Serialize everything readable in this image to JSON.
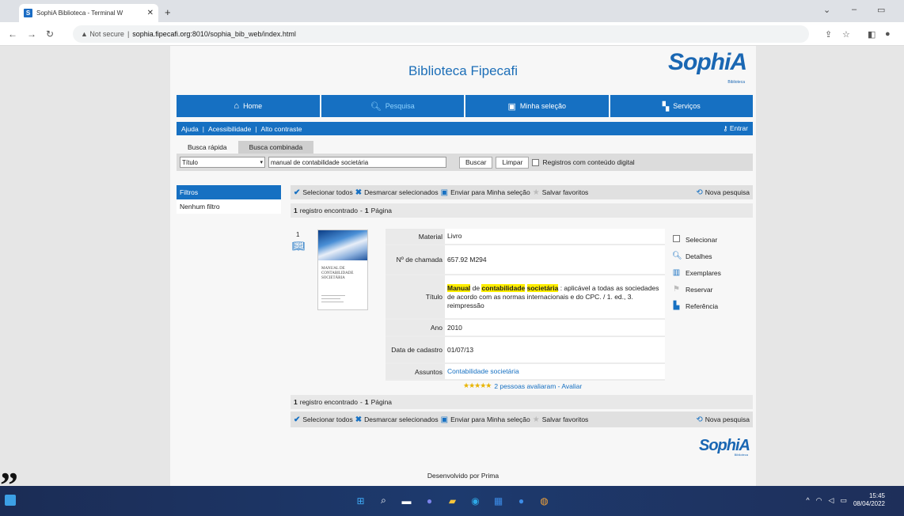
{
  "browser": {
    "tab_title": "SophiA Biblioteca - Terminal W",
    "favicon_letter": "S",
    "tab_close": "✕",
    "new_tab": "+",
    "security_label": "▲ Not secure",
    "url_host": "sophia.fipecafi.org",
    "url_path": ":8010/sophia_bib_web/index.html"
  },
  "header": {
    "title": "Biblioteca Fipecafi",
    "logo": "SophiA",
    "logo_sub": "Biblioteca"
  },
  "main_nav": [
    {
      "label": "Home",
      "icon": "home-icon"
    },
    {
      "label": "Pesquisa",
      "icon": "search-icon"
    },
    {
      "label": "Minha seleção",
      "icon": "gift-icon"
    },
    {
      "label": "Serviços",
      "icon": "services-icon"
    }
  ],
  "sub_nav": {
    "ajuda": "Ajuda",
    "acessibilidade": "Acessibilidade",
    "alto_contraste": "Alto contraste",
    "entrar": "Entrar"
  },
  "search": {
    "tabs": [
      "Busca rápida",
      "Busca combinada"
    ],
    "field_select": "Título",
    "query": "manual de contabilidade societária",
    "buscar": "Buscar",
    "limpar": "Limpar",
    "digital_label": "Registros com conteúdo digital"
  },
  "filters": {
    "title": "Filtros",
    "none": "Nenhum filtro"
  },
  "actions": {
    "select_all": "Selecionar todos",
    "deselect": "Desmarcar selecionados",
    "send": "Enviar para Minha seleção",
    "save_fav": "Salvar favoritos",
    "new_search": "Nova pesquisa"
  },
  "results_count": {
    "count": "1",
    "found_text": "registro encontrado",
    "dash": "-",
    "page_count": "1",
    "page_text": "Página"
  },
  "record": {
    "index": "1",
    "cover_text": "MANUAL DE CONTABILIDADE SOCIETÁRIA",
    "rows": {
      "material_label": "Material",
      "material": "Livro",
      "chamada_label": "Nº de chamada",
      "chamada": "657.92 M294",
      "titulo_label": "Título",
      "titulo_hl1": "Manual",
      "titulo_mid": " de ",
      "titulo_hl2": "contabilidade",
      "titulo_hl3": "societária",
      "titulo_rest": " : aplicável a todas as sociedades de acordo com as normas internacionais e do CPC. / 1. ed., 3. reimpressão",
      "ano_label": "Ano",
      "ano": "2010",
      "cadastro_label": "Data de cadastro",
      "cadastro": "01/07/13",
      "assuntos_label": "Assuntos",
      "assuntos": "Contabilidade societária"
    },
    "rating_text": "2 pessoas avaliaram - Avaliar",
    "rating_stars": 5,
    "side_actions": [
      "Selecionar",
      "Detalhes",
      "Exemplares",
      "Reservar",
      "Referência"
    ]
  },
  "footer": {
    "text": "Desenvolvido por Prima",
    "logo": "SophiA",
    "logo_sub": "Biblioteca"
  },
  "taskbar": {
    "time": "15:45",
    "date": "08/04/2022"
  }
}
